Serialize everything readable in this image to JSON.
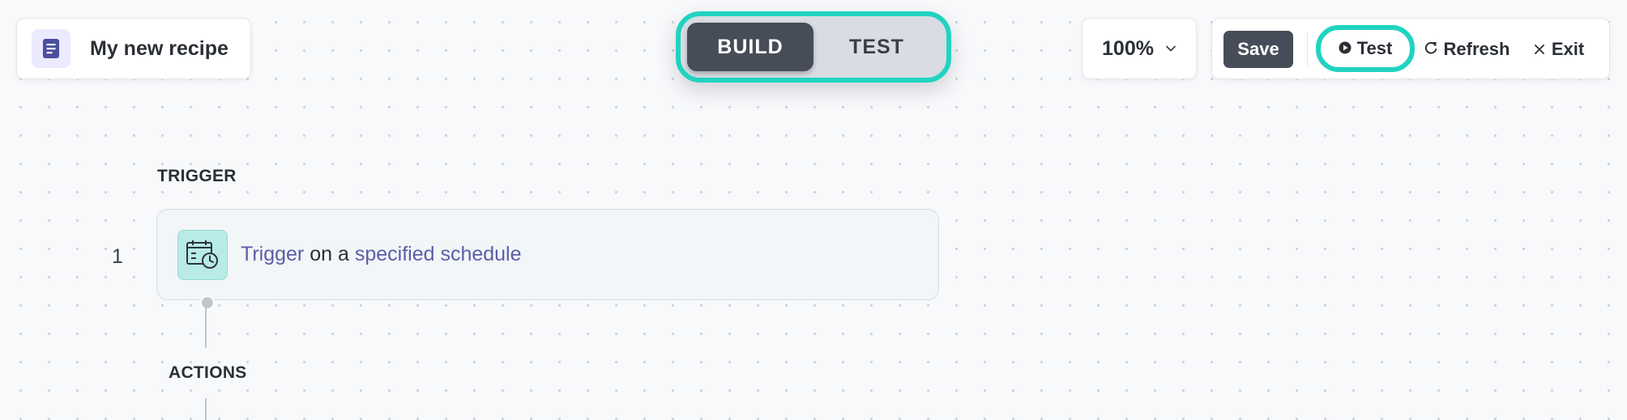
{
  "header": {
    "recipe_name": "My new recipe",
    "recipe_icon": "document-icon"
  },
  "mode_switch": {
    "build_label": "BUILD",
    "test_label": "TEST",
    "active": "BUILD",
    "highlight_color": "#21d3c0"
  },
  "zoom": {
    "value": "100%"
  },
  "toolbar": {
    "save_label": "Save",
    "test_label": "Test",
    "refresh_label": "Refresh",
    "exit_label": "Exit"
  },
  "flow": {
    "trigger_heading": "TRIGGER",
    "actions_heading": "ACTIONS",
    "steps": [
      {
        "number": "1",
        "icon": "calendar-clock-icon",
        "parts": {
          "verb": "Trigger",
          "connector": " on a ",
          "object": "specified schedule"
        }
      }
    ]
  },
  "colors": {
    "accent": "#5b5ea6",
    "dark_button": "#474d58",
    "highlight": "#21d3c0",
    "icon_bg": "#b9ebe6"
  }
}
